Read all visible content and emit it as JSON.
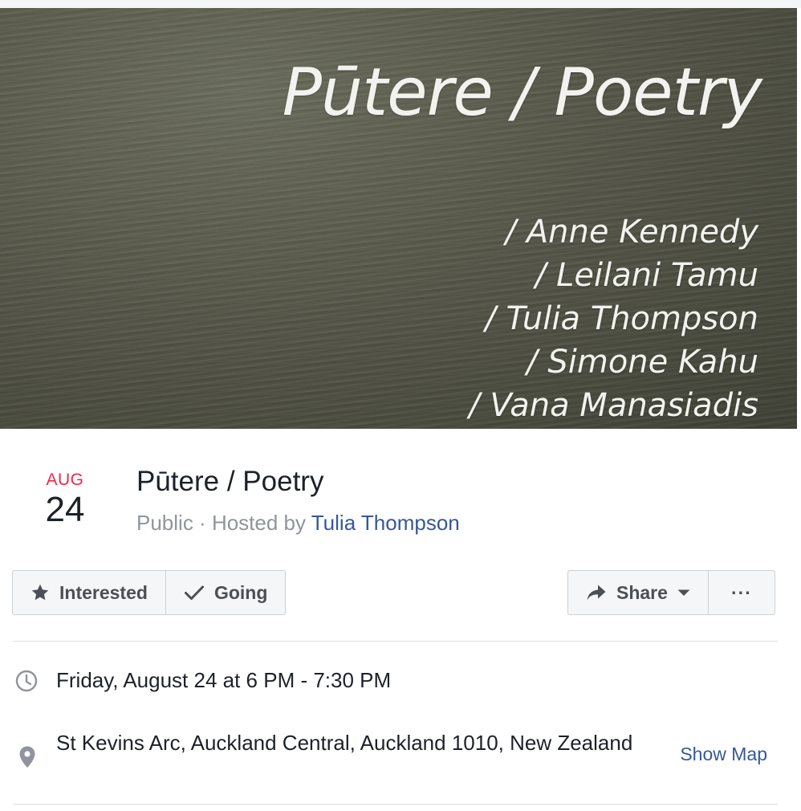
{
  "cover": {
    "title": "Pūtere / Poetry",
    "names": [
      "/ Anne Kennedy",
      "/ Leilani Tamu",
      "/ Tulia Thompson",
      "/ Simone Kahu",
      "/ Vana Manasiadis"
    ]
  },
  "event": {
    "month": "AUG",
    "day": "24",
    "title": "Pūtere / Poetry",
    "privacy": "Public",
    "separator": " · ",
    "hosted_by_label": "Hosted by ",
    "host": "Tulia Thompson"
  },
  "actions": {
    "interested_label": "Interested",
    "going_label": "Going",
    "share_label": "Share",
    "more_label": "···"
  },
  "details": {
    "time": "Friday, August 24 at 6 PM - 7:30 PM",
    "location": "St Kevins Arc, Auckland Central, Auckland 1010, New Zealand",
    "show_map_label": "Show Map"
  },
  "colors": {
    "month_red": "#f02849",
    "link_blue": "#365899",
    "text_dark": "#1d2129",
    "text_gray": "#90949c",
    "button_bg": "#f5f6f7",
    "border": "#ccd0d5"
  },
  "icons": {
    "interested": "star-icon",
    "going": "checkmark-icon",
    "share": "share-arrow-icon",
    "share_dropdown": "caret-down-icon",
    "time": "clock-icon",
    "location": "map-pin-icon"
  }
}
